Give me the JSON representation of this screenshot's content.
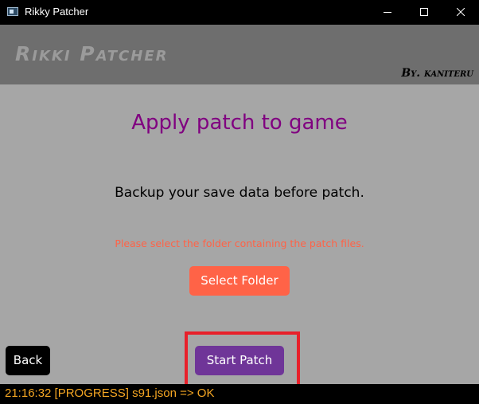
{
  "window": {
    "title": "Rikky Patcher"
  },
  "header": {
    "brand": "Rikki Patcher",
    "byline": "By. kaniteru"
  },
  "main": {
    "heading": "Apply patch to game",
    "warning": "Backup your save data before patch.",
    "instruction": "Please select the folder containing the patch files.",
    "select_folder_label": "Select Folder",
    "start_patch_label": "Start Patch",
    "back_label": "Back"
  },
  "log": {
    "line": "21:16:32 [PROGRESS] s91.json => OK"
  },
  "icons": {
    "app": "app-window-icon",
    "minimize": "minimize-icon",
    "maximize": "maximize-icon",
    "close": "close-icon"
  },
  "colors": {
    "titlebar": "#000000",
    "header_band": "#6e6e6e",
    "background": "#a6a6a6",
    "heading": "#800080",
    "instruction": "#ff6347",
    "select_folder_button": "#ff6347",
    "start_patch_button": "#6f3598",
    "back_button": "#000000",
    "highlight_box": "#e8202a",
    "log_text": "#f5a623"
  }
}
